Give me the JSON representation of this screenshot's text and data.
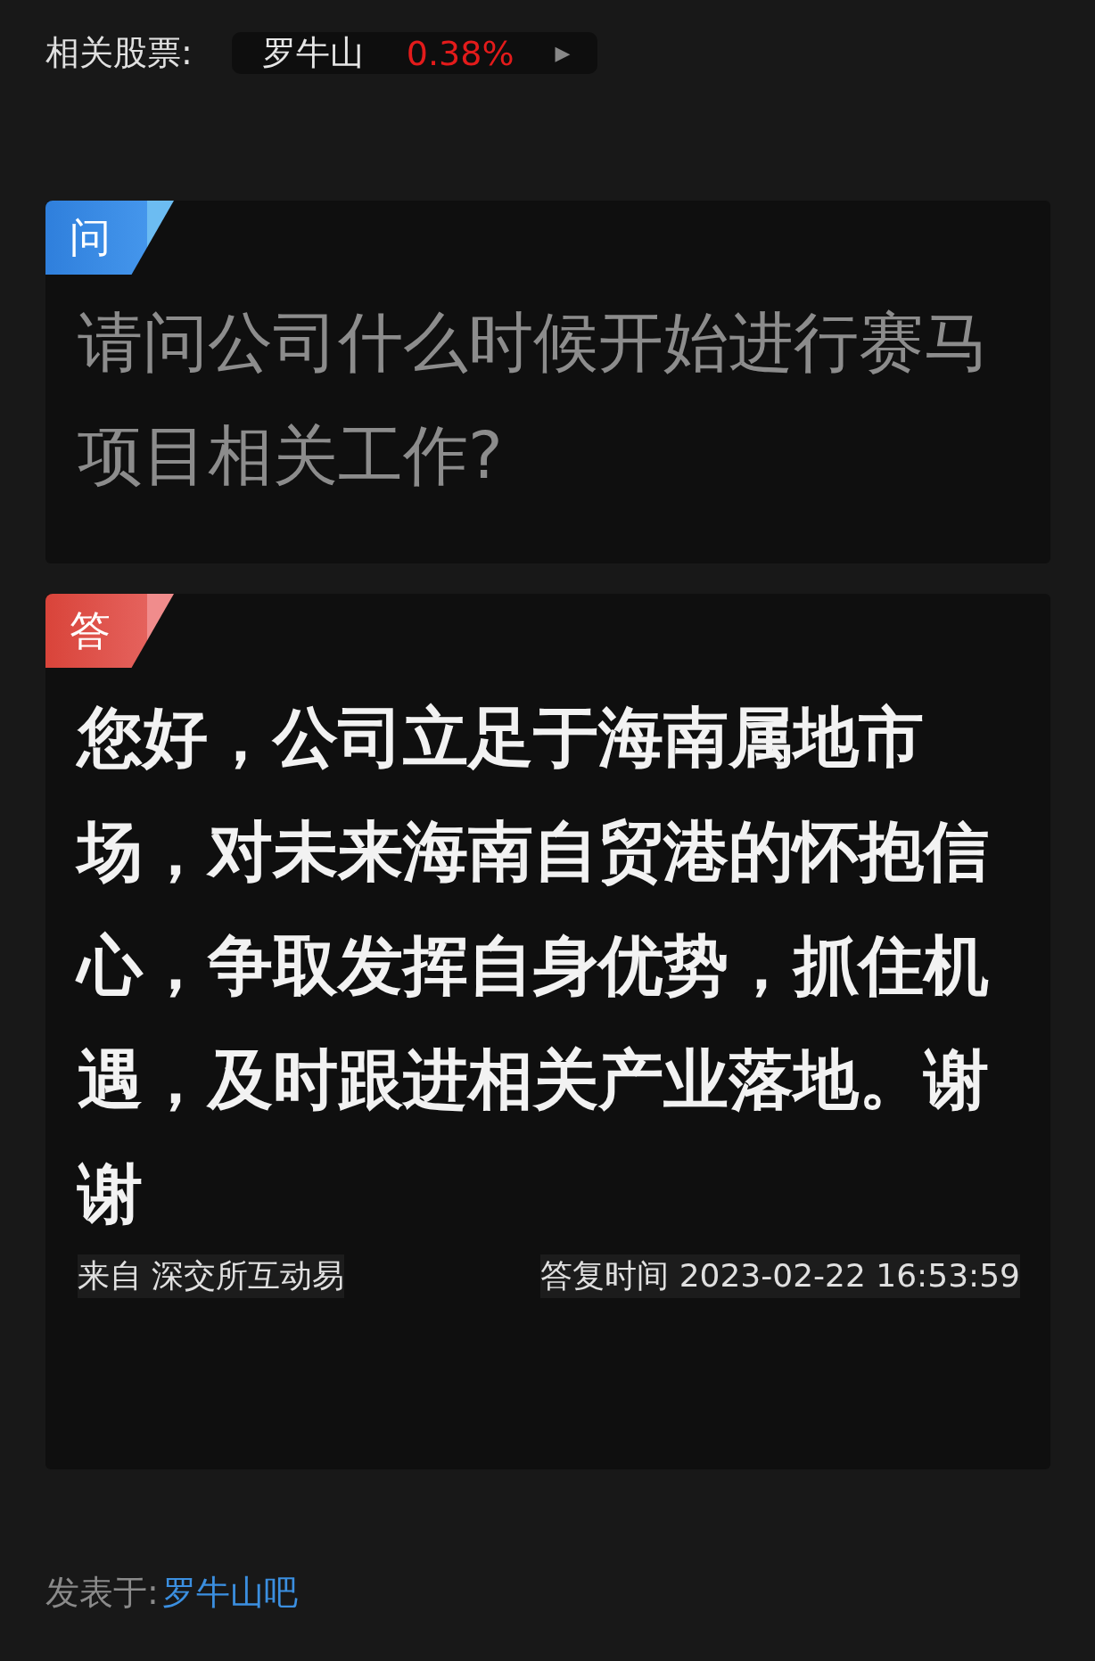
{
  "related_stock": {
    "label": "相关股票:",
    "name": "罗牛山",
    "change": "0.38%",
    "arrow": "▶"
  },
  "question": {
    "badge": "问",
    "text": "请问公司什么时候开始进行赛马项目相关工作?"
  },
  "answer": {
    "badge": "答",
    "text": "您好，公司立足于海南属地市场，对未来海南自贸港的怀抱信心，争取发挥自身优势，抓住机遇，及时跟进相关产业落地。谢谢",
    "source": "来自 深交所互动易",
    "reply_time": "答复时间 2023-02-22 16:53:59"
  },
  "posted_in": {
    "label": "发表于:",
    "link": "罗牛山吧"
  }
}
